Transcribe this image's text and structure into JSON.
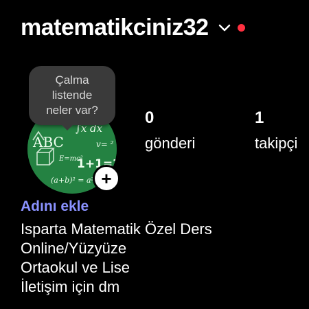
{
  "header": {
    "username": "matematikciniz32",
    "notification_color": "#ff3040"
  },
  "avatar": {
    "icon": "math-chalkboard-avatar",
    "board_text": {
      "abc": "ABC",
      "integral": "∫x dx",
      "sum": "1+1=2",
      "formula": "(a+b)² = a²"
    }
  },
  "tooltip": {
    "text": "Çalma listende neler var?"
  },
  "stats": {
    "posts": {
      "value": "0",
      "label": "gönderi"
    },
    "followers": {
      "value": "1",
      "label": "takipçi"
    }
  },
  "profile": {
    "add_name": "Adını ekle",
    "bio": [
      "Isparta Matematik Özel Ders",
      "Online/Yüzyüze",
      "Ortaokul ve Lise",
      "İletişim için dm"
    ]
  }
}
